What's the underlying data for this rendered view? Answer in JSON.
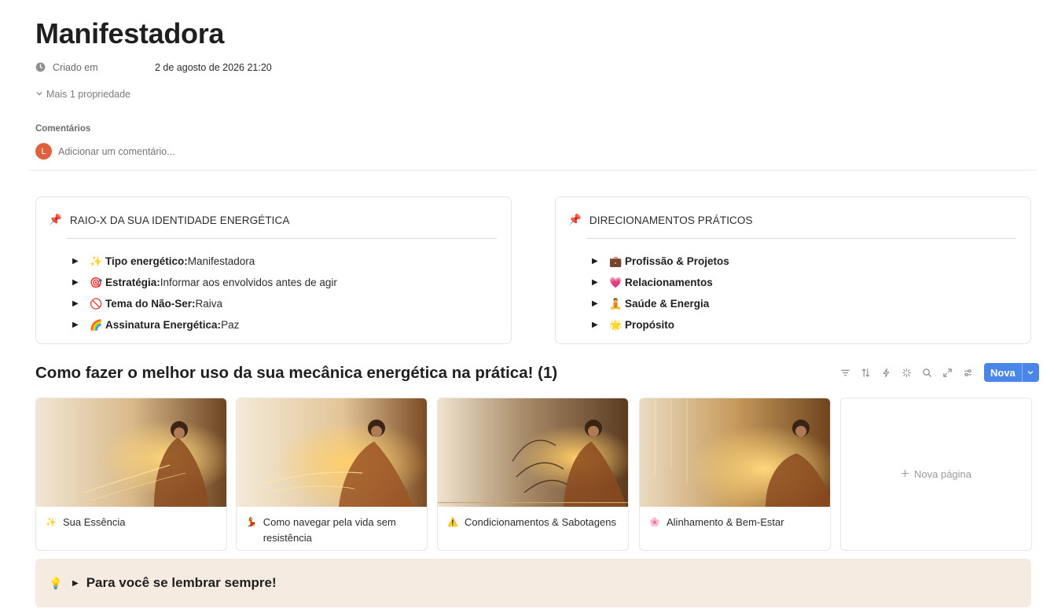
{
  "page": {
    "title": "Manifestadora"
  },
  "properties": {
    "created_label": "Criado em",
    "created_value": "2 de agosto de 2026 21:20",
    "more_label": "Mais 1 propriedade"
  },
  "comments": {
    "title": "Comentários",
    "avatar_letter": "L",
    "placeholder": "Adicionar um comentário..."
  },
  "callout_left": {
    "emoji": "📌",
    "title": "RAIO-X DA SUA IDENTIDADE ENERGÉTICA",
    "items": [
      {
        "emoji": "✨",
        "label": "Tipo energético:",
        "value": " Manifestadora"
      },
      {
        "emoji": "🎯",
        "label": "Estratégia:",
        "value": " Informar aos envolvidos antes de agir"
      },
      {
        "emoji": "🚫",
        "label": "Tema do Não-Ser:",
        "value": " Raiva"
      },
      {
        "emoji": "🌈",
        "label": "Assinatura Energética:",
        "value": " Paz"
      }
    ]
  },
  "callout_right": {
    "emoji": "📌",
    "title": "DIRECIONAMENTOS PRÁTICOS",
    "items": [
      {
        "emoji": "💼",
        "label": "Profissão & Projetos"
      },
      {
        "emoji": "💗",
        "label": "Relacionamentos"
      },
      {
        "emoji": "🧘",
        "label": "Saúde & Energia"
      },
      {
        "emoji": "🌟",
        "label": "Propósito"
      }
    ]
  },
  "database": {
    "title": "Como fazer o melhor uso da sua mecânica energética na prática! (1)",
    "new_label": "Nova",
    "new_page_label": "Nova página",
    "icons": [
      "filter-icon",
      "sort-icon",
      "automation-icon",
      "ai-icon",
      "search-icon",
      "expand-icon",
      "settings-icon"
    ],
    "cards": [
      {
        "emoji": "✨",
        "title": "Sua Essência"
      },
      {
        "emoji": "💃",
        "title": "Como navegar pela vida sem resistência"
      },
      {
        "emoji": "⚠️",
        "title": "Condicionamentos & Sabotagens"
      },
      {
        "emoji": "🌸",
        "title": "Alinhamento & Bem-Estar"
      }
    ]
  },
  "bottom_callout": {
    "emoji": "💡",
    "title": "Para você se lembrar sempre!"
  },
  "colors": {
    "accent": "#4a86e8",
    "avatar": "#e0603b",
    "callout_bg": "#f6ebe0"
  }
}
